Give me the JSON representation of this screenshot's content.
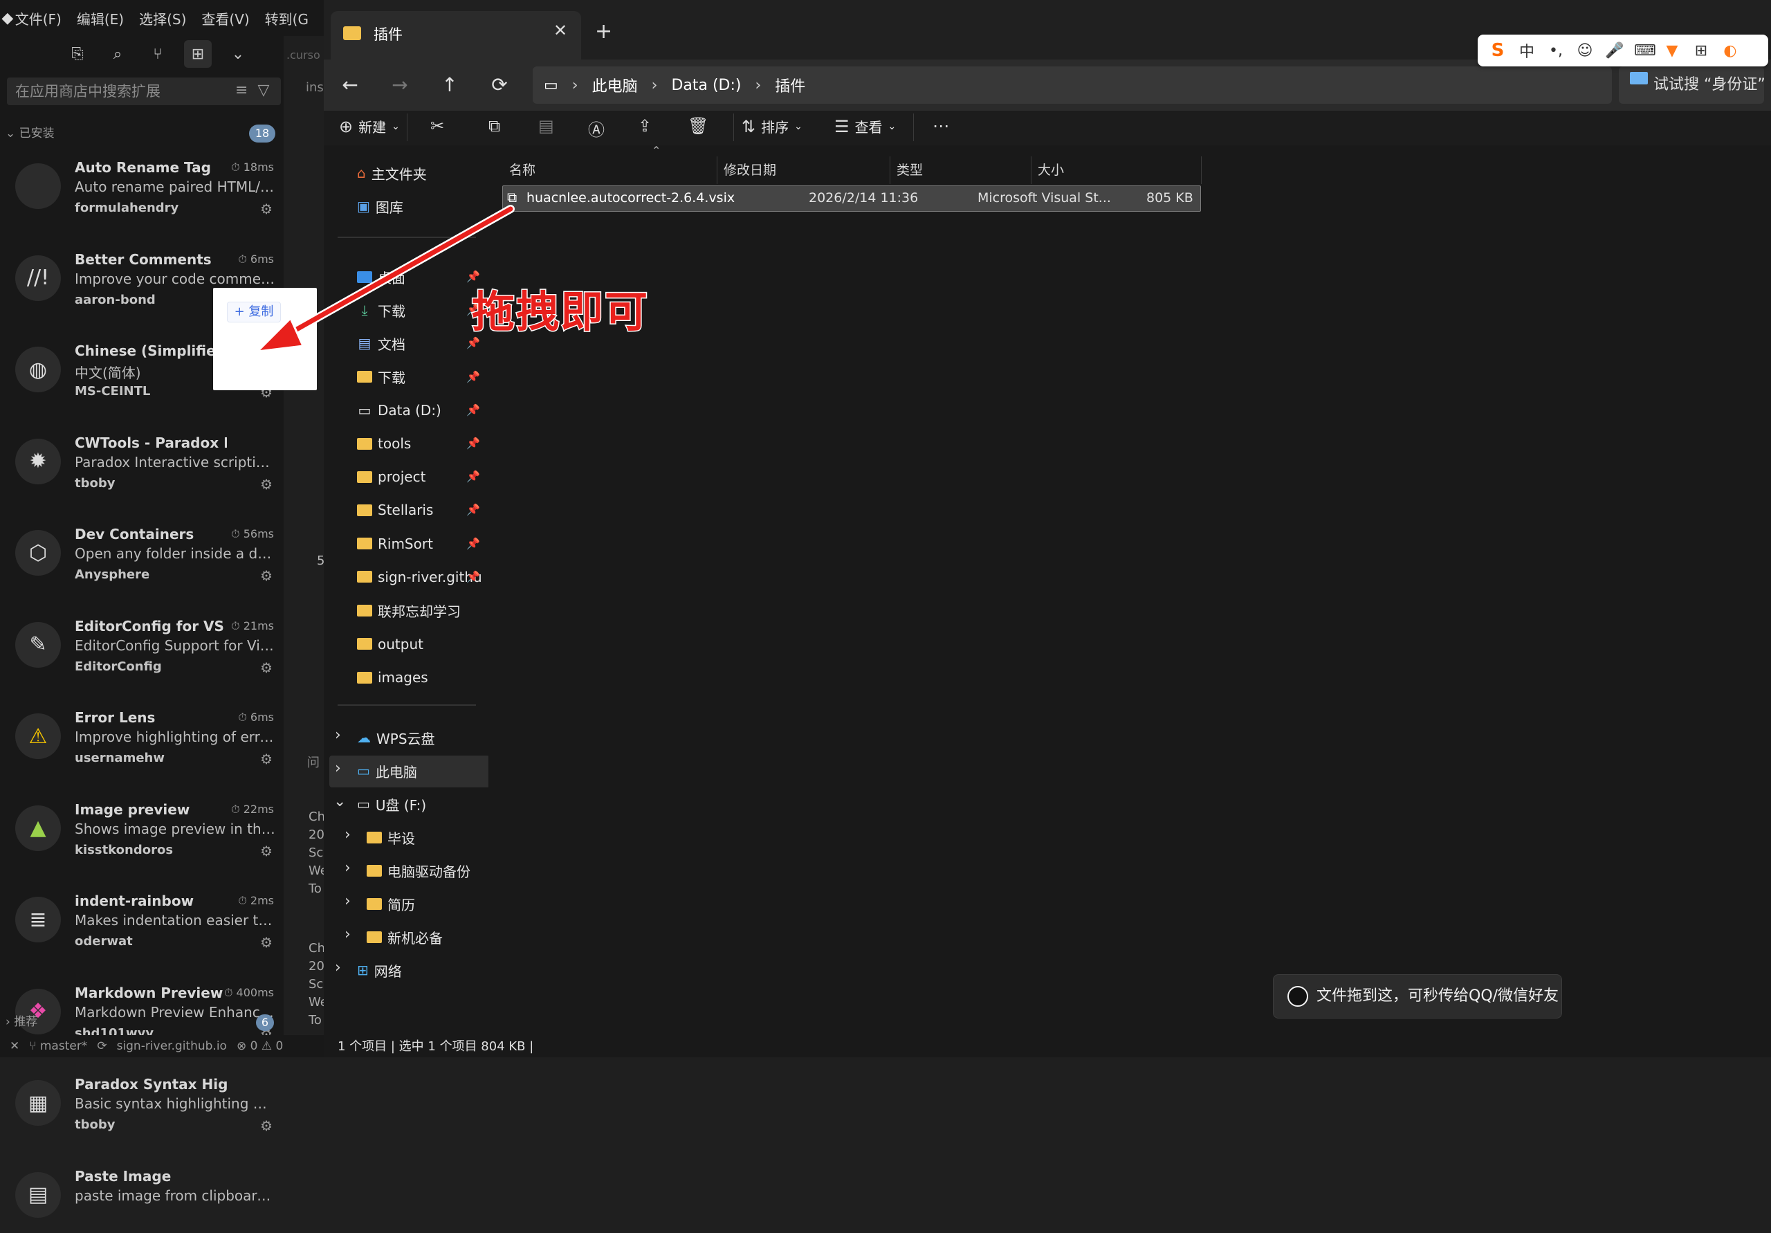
{
  "vscode": {
    "menus": [
      "文件(F)",
      "编辑(E)",
      "选择(S)",
      "查看(V)",
      "转到(G"
    ],
    "search_placeholder": "在应用商店中搜索扩展",
    "installed_label": "已安装",
    "installed_count": "18",
    "extensions": [
      {
        "name": "Auto Rename Tag",
        "time": "18ms",
        "desc": "Auto rename paired HTML/XML...",
        "author": "formulahendry",
        "icon": "tag-icon"
      },
      {
        "name": "Better Comments",
        "time": "6ms",
        "desc": "Improve your code commentin...",
        "author": "aaron-bond",
        "icon": "comment-icon"
      },
      {
        "name": "Chinese (Simplified) (",
        "time": "",
        "desc": "中文(简体)",
        "author": "MS-CEINTL",
        "icon": "globe-icon"
      },
      {
        "name": "CWTools - Paradox La",
        "time": "",
        "desc": "Paradox Interactive scripting file...",
        "author": "tboby",
        "icon": "gear-cog-icon"
      },
      {
        "name": "Dev Containers",
        "time": "56ms",
        "desc": "Open any folder inside a dev co...",
        "author": "Anysphere",
        "icon": "cube-icon"
      },
      {
        "name": "EditorConfig for VS C...",
        "time": "21ms",
        "desc": "EditorConfig Support for Visual ...",
        "author": "EditorConfig",
        "icon": "mouse-icon"
      },
      {
        "name": "Error Lens",
        "time": "6ms",
        "desc": "Improve highlighting of errors, ...",
        "author": "usernamehw",
        "icon": "warning-icon"
      },
      {
        "name": "Image preview",
        "time": "22ms",
        "desc": "Shows image preview in the gut...",
        "author": "kisstkondoros",
        "icon": "image-icon"
      },
      {
        "name": "indent-rainbow",
        "time": "2ms",
        "desc": "Makes indentation easier to read",
        "author": "oderwat",
        "icon": "indent-icon"
      },
      {
        "name": "Markdown Preview E...",
        "time": "400ms",
        "desc": "Markdown Preview Enhanced p...",
        "author": "shd101wyy",
        "icon": "markdown-icon"
      },
      {
        "name": "Paradox Syntax Highlighting",
        "time": "",
        "desc": "Basic syntax highlighting files fo...",
        "author": "tboby",
        "icon": "syntax-icon"
      },
      {
        "name": "Paste Image",
        "time": "",
        "desc": "paste image from clipboard dir...",
        "author": "",
        "icon": "clipboard-icon"
      }
    ],
    "recommended_label": "推荐",
    "recommended_count": "6",
    "status": {
      "branch": "master*",
      "repo": "sign-river.github.io",
      "problems": "⊗ 0 ⚠ 0"
    },
    "sliver": {
      "tab": ".curso",
      "ins": "ins",
      "num": "5",
      "p": "问",
      "lines": [
        "Ch",
        "20",
        "Sc",
        "We",
        "To",
        "Ch",
        "20",
        "Sc",
        "We",
        "To"
      ]
    }
  },
  "copy_popup": {
    "label": "+ 复制"
  },
  "explorer": {
    "tab_title": "插件",
    "breadcrumb": [
      "此电脑",
      "Data (D:)",
      "插件"
    ],
    "search_text": "试试搜 “身份证”",
    "commands": {
      "new": "新建",
      "sort": "排序",
      "view": "查看"
    },
    "nav": {
      "home": "主文件夹",
      "gallery": "图库",
      "pinned": [
        "桌面",
        "下载",
        "文档",
        "下载",
        "Data (D:)",
        "tools",
        "project",
        "Stellaris",
        "RimSort",
        "sign-river.githu"
      ],
      "others": [
        "联邦忘却学习",
        "output",
        "images"
      ],
      "wps": "WPS云盘",
      "thispc": "此电脑",
      "usb": "U盘 (F:)",
      "usb_children": [
        "毕设",
        "电脑驱动备份",
        "简历",
        "新机必备"
      ],
      "network": "网络"
    },
    "columns": [
      "名称",
      "修改日期",
      "类型",
      "大小"
    ],
    "file": {
      "name": "huacnlee.autocorrect-2.6.4.vsix",
      "date": "2026/2/14 11:36",
      "type": "Microsoft Visual St...",
      "size": "805 KB"
    },
    "status": "1 个项目  |  选中 1 个项目  804 KB  |"
  },
  "annotation": {
    "text": "拖拽即可",
    "color": "#e8201c"
  },
  "toast": {
    "text": "文件拖到这，可秒传给QQ/微信好友"
  },
  "ime": {
    "mode": "中"
  }
}
